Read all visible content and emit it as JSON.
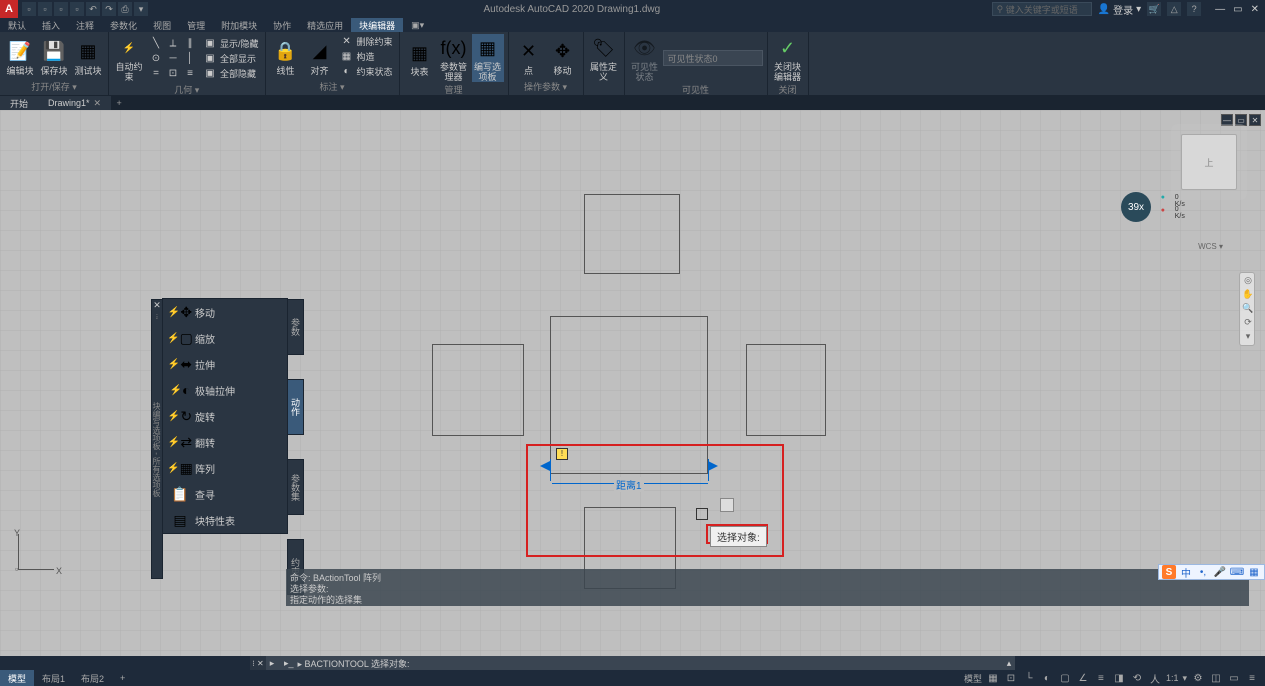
{
  "app": {
    "title": "Autodesk AutoCAD 2020   Drawing1.dwg",
    "search_placeholder": "键入关键字或短语",
    "login": "登录"
  },
  "menu": {
    "items": [
      "默认",
      "插入",
      "注释",
      "参数化",
      "视图",
      "管理",
      "附加模块",
      "协作",
      "精选应用",
      "块编辑器"
    ],
    "active_index": 9
  },
  "ribbon": {
    "panels": [
      {
        "title": "打开/保存 ▾",
        "buttons": [
          {
            "label": "编辑块"
          },
          {
            "label": "保存块"
          },
          {
            "label": "测试块"
          }
        ]
      },
      {
        "title": "几何 ▾",
        "buttons": [
          {
            "label": "自动约束"
          }
        ],
        "rows": [
          "显示/隐藏",
          "全部显示",
          "全部隐藏"
        ]
      },
      {
        "title": "标注 ▾",
        "buttons": [
          {
            "label": "线性"
          },
          {
            "label": "对齐"
          }
        ],
        "rows": [
          "删除约束",
          "构造",
          "约束状态"
        ]
      },
      {
        "title": "管理",
        "buttons": [
          {
            "label": "块表"
          },
          {
            "label": "参数管理器"
          },
          {
            "label": "编写选项板"
          }
        ]
      },
      {
        "title": "操作参数 ▾",
        "buttons": [
          {
            "label": "点"
          },
          {
            "label": "移动"
          }
        ]
      },
      {
        "title": "",
        "buttons": [
          {
            "label": "属性定义"
          }
        ]
      },
      {
        "title": "可见性",
        "buttons": [
          {
            "label": "可见性状态"
          }
        ],
        "select": "可见性状态0"
      },
      {
        "title": "关闭",
        "buttons": [
          {
            "label": "关闭块编辑器"
          }
        ]
      }
    ]
  },
  "tabs": {
    "items": [
      "开始",
      "Drawing1*"
    ]
  },
  "palette": {
    "title": "块编写选项板 - 所有选项板",
    "side_tabs": [
      "参数",
      "动作",
      "参数集",
      "约束"
    ],
    "items": [
      "移动",
      "缩放",
      "拉伸",
      "极轴拉伸",
      "旋转",
      "翻转",
      "阵列",
      "查寻",
      "块特性表"
    ]
  },
  "drawing": {
    "dim_label": "距离1",
    "tooltip": "选择对象:"
  },
  "nav": {
    "cube_face": "上",
    "wcs": "WCS ▾",
    "speed": "39x",
    "km1": "0 K/s",
    "km2": "0 K/s"
  },
  "cmd": {
    "history": [
      "命令: BActionTool 阵列",
      "选择参数:",
      "指定动作的选择集"
    ],
    "prompt_prefix": "▸ BACTIONTOOL 选择对象:",
    "prompt_icon": "▸"
  },
  "ime": {
    "lang": "中"
  },
  "status": {
    "tabs": [
      "模型",
      "布局1",
      "布局2",
      "+"
    ],
    "active_index": 0,
    "right_label": "模型",
    "ratio": "1:1"
  },
  "ucs": {
    "x": "X",
    "y": "Y"
  }
}
